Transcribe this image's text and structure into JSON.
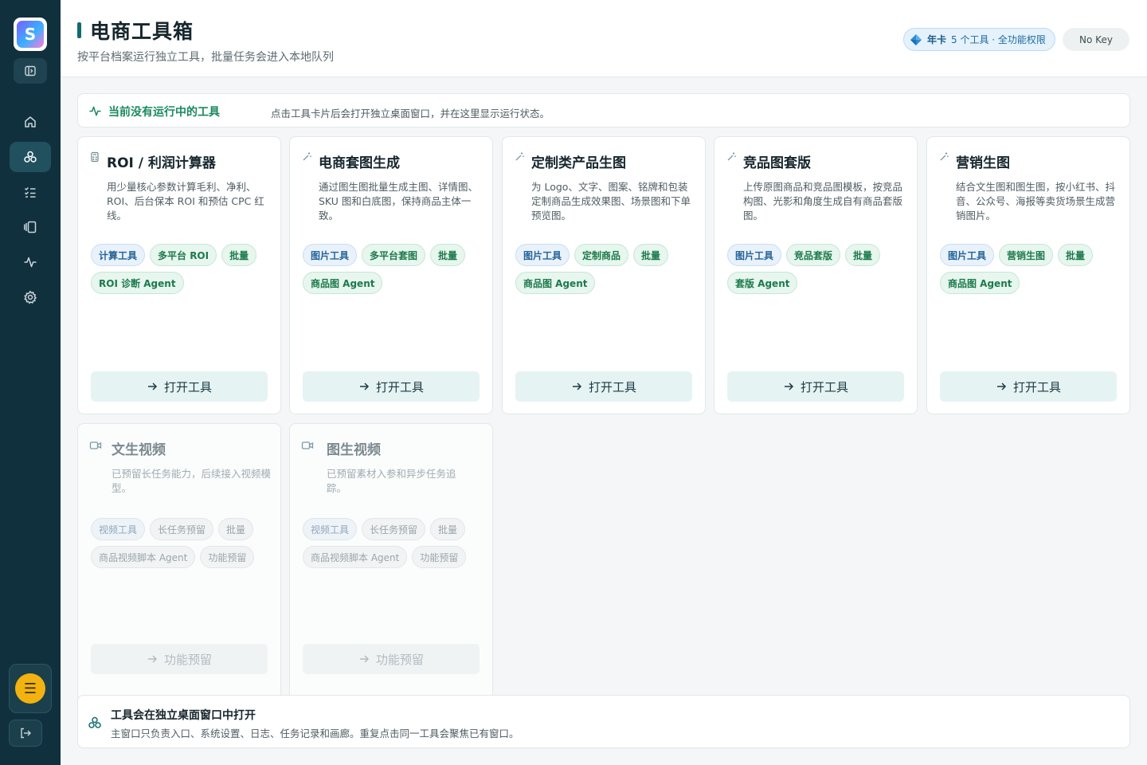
{
  "sidebar": {
    "logo_letter": "S",
    "user_initial": "☰",
    "nav": [
      {
        "name": "home-icon"
      },
      {
        "name": "tools-icon",
        "active": true
      },
      {
        "name": "tasks-icon"
      },
      {
        "name": "gallery-icon"
      },
      {
        "name": "activity-icon"
      },
      {
        "name": "settings-icon"
      }
    ]
  },
  "header": {
    "title": "电商工具箱",
    "subtitle": "按平台档案运行独立工具，批量任务会进入本地队列",
    "plan_name": "年卡",
    "plan_detail": "5 个工具 · 全功能权限",
    "key_status": "No Key"
  },
  "status": {
    "title": "当前没有运行中的工具",
    "description": "点击工具卡片后会打开独立桌面窗口，并在这里显示运行状态。"
  },
  "cards": [
    {
      "title": "ROI / 利润计算器",
      "description": "用少量核心参数计算毛利、净利、ROI、后台保本 ROI 和预估 CPC 红线。",
      "tags": [
        {
          "label": "计算工具",
          "style": "blue"
        },
        {
          "label": "多平台 ROI",
          "style": "green"
        },
        {
          "label": "批量",
          "style": "green"
        },
        {
          "label": "ROI 诊断 Agent",
          "style": "green"
        }
      ],
      "button": "打开工具"
    },
    {
      "title": "电商套图生成",
      "description": "通过图生图批量生成主图、详情图、SKU 图和白底图，保持商品主体一致。",
      "tags": [
        {
          "label": "图片工具",
          "style": "blue"
        },
        {
          "label": "多平台套图",
          "style": "green"
        },
        {
          "label": "批量",
          "style": "green"
        },
        {
          "label": "商品图 Agent",
          "style": "green"
        }
      ],
      "button": "打开工具"
    },
    {
      "title": "定制类产品生图",
      "description": "为 Logo、文字、图案、铭牌和包装定制商品生成效果图、场景图和下单预览图。",
      "tags": [
        {
          "label": "图片工具",
          "style": "blue"
        },
        {
          "label": "定制商品",
          "style": "green"
        },
        {
          "label": "批量",
          "style": "green"
        },
        {
          "label": "商品图 Agent",
          "style": "green"
        }
      ],
      "button": "打开工具"
    },
    {
      "title": "竞品图套版",
      "description": "上传原图商品和竞品图模板，按竞品构图、光影和角度生成自有商品套版图。",
      "tags": [
        {
          "label": "图片工具",
          "style": "blue"
        },
        {
          "label": "竞品套版",
          "style": "green"
        },
        {
          "label": "批量",
          "style": "green"
        },
        {
          "label": "套版 Agent",
          "style": "green"
        }
      ],
      "button": "打开工具"
    },
    {
      "title": "营销生图",
      "description": "结合文生图和图生图，按小红书、抖音、公众号、海报等卖货场景生成营销图片。",
      "tags": [
        {
          "label": "图片工具",
          "style": "blue"
        },
        {
          "label": "营销生图",
          "style": "green"
        },
        {
          "label": "批量",
          "style": "green"
        },
        {
          "label": "商品图 Agent",
          "style": "green"
        }
      ],
      "button": "打开工具"
    },
    {
      "title": "文生视频",
      "description": "已预留长任务能力，后续接入视频模型。",
      "tags": [
        {
          "label": "视频工具",
          "style": "gray-blue"
        },
        {
          "label": "长任务预留",
          "style": "gray"
        },
        {
          "label": "批量",
          "style": "gray"
        },
        {
          "label": "商品视频脚本 Agent",
          "style": "gray"
        },
        {
          "label": "功能预留",
          "style": "gray"
        }
      ],
      "button": "功能预留",
      "disabled": true
    },
    {
      "title": "图生视频",
      "description": "已预留素材入参和异步任务追踪。",
      "tags": [
        {
          "label": "视频工具",
          "style": "gray-blue"
        },
        {
          "label": "长任务预留",
          "style": "gray"
        },
        {
          "label": "批量",
          "style": "gray"
        },
        {
          "label": "商品视频脚本 Agent",
          "style": "gray"
        },
        {
          "label": "功能预留",
          "style": "gray"
        }
      ],
      "button": "功能预留",
      "disabled": true
    }
  ],
  "footer": {
    "title": "工具会在独立桌面窗口中打开",
    "description": "主窗口只负责入口、系统设置、日志、任务记录和画廊。重复点击同一工具会聚焦已有窗口。"
  },
  "colors": {
    "sidebar": "#11303d",
    "accent": "#0f6b70",
    "status_green": "#1a8a5e"
  }
}
